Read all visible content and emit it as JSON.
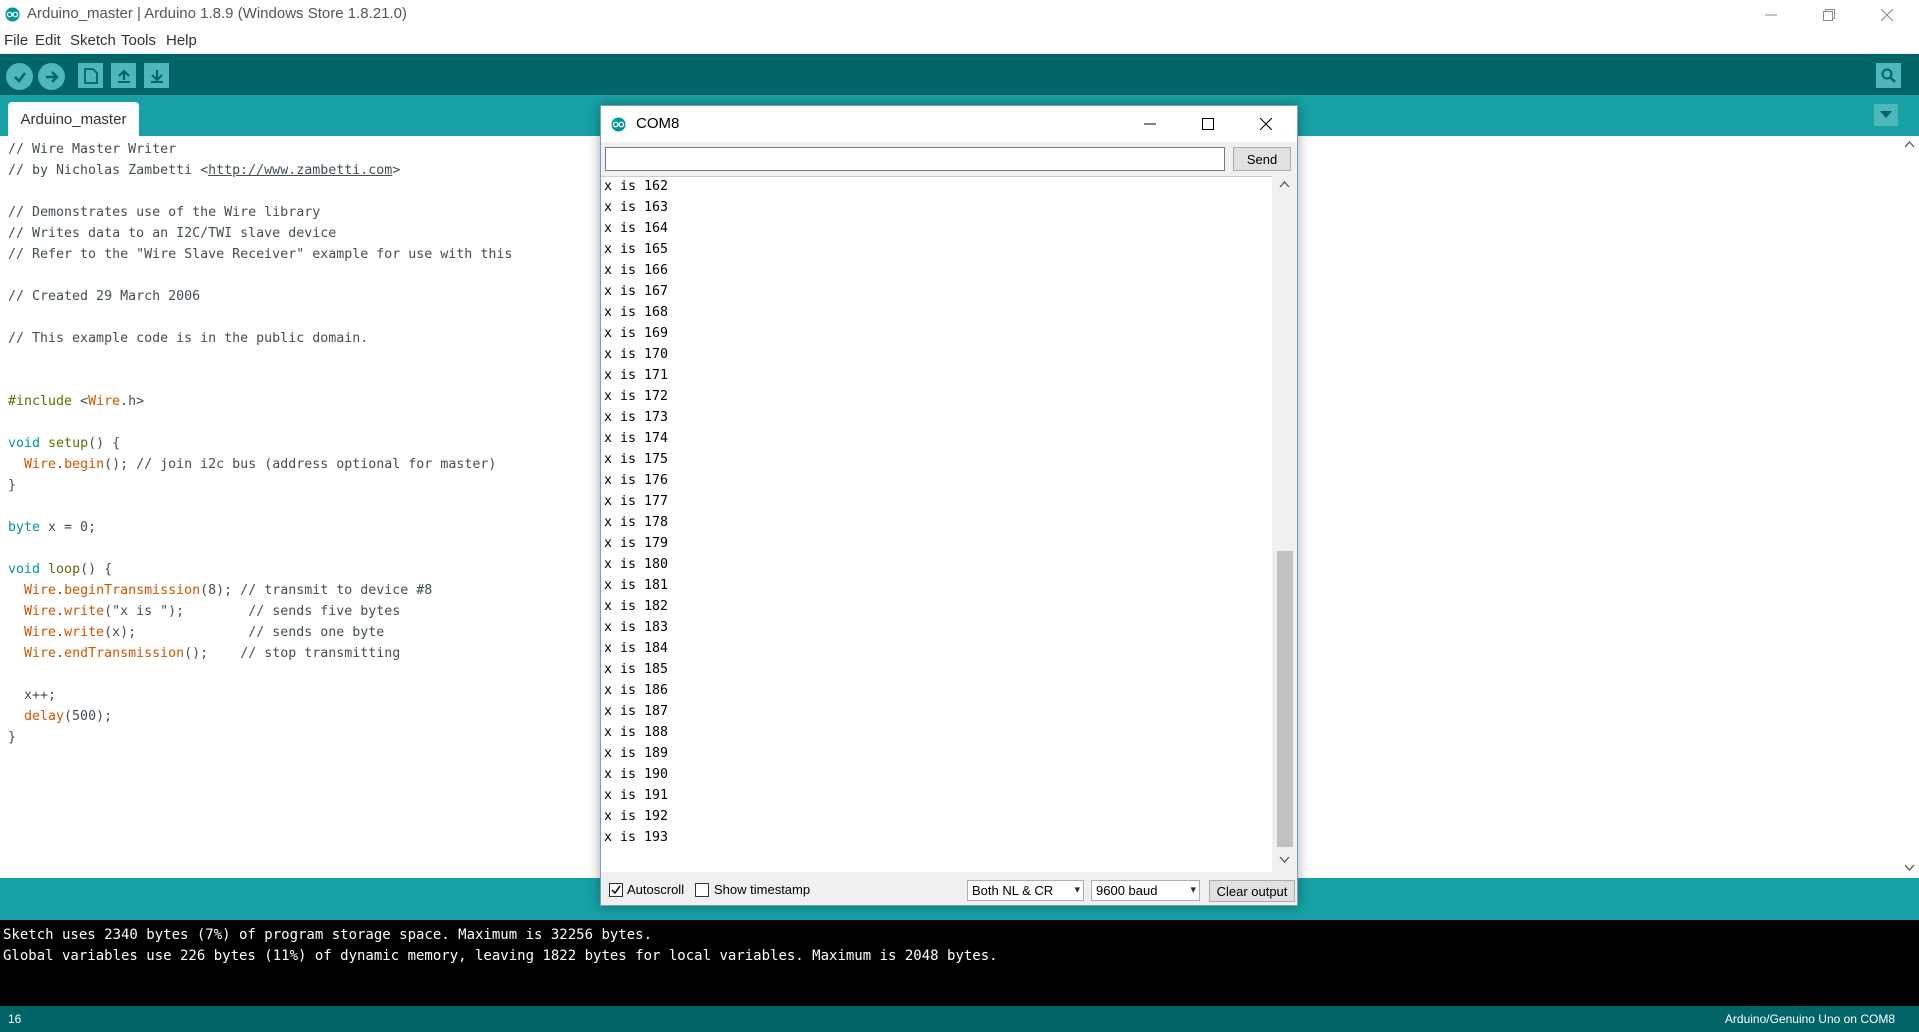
{
  "window": {
    "title": "Arduino_master | Arduino 1.8.9 (Windows Store 1.8.21.0)",
    "minimize": "—",
    "restore": "❐",
    "close": "✕"
  },
  "menu": [
    "File",
    "Edit",
    "Sketch",
    "Tools",
    "Help"
  ],
  "toolbar": {
    "verify": "✓",
    "upload": "→",
    "new": "new-icon",
    "open": "open-icon",
    "save": "save-icon",
    "serial_monitor": "serial-monitor-icon"
  },
  "tab": {
    "label": "Arduino_master"
  },
  "code_lines": [
    "// Wire Master Writer",
    "// by Nicholas Zambetti <http://www.zambetti.com>",
    "",
    "// Demonstrates use of the Wire library",
    "// Writes data to an I2C/TWI slave device",
    "// Refer to the \"Wire Slave Receiver\" example for use with this",
    "",
    "// Created 29 March 2006",
    "",
    "// This example code is in the public domain.",
    "",
    "",
    "#include <Wire.h>",
    "",
    "void setup() {",
    "  Wire.begin(); // join i2c bus (address optional for master)",
    "}",
    "",
    "byte x = 0;",
    "",
    "void loop() {",
    "  Wire.beginTransmission(8); // transmit to device #8",
    "  Wire.write(\"x is \");        // sends five bytes",
    "  Wire.write(x);              // sends one byte",
    "  Wire.endTransmission();    // stop transmitting",
    "",
    "  x++;",
    "  delay(500);",
    "}"
  ],
  "console": [
    "Sketch uses 2340 bytes (7%) of program storage space. Maximum is 32256 bytes.",
    "Global variables use 226 bytes (11%) of dynamic memory, leaving 1822 bytes for local variables. Maximum is 2048 bytes."
  ],
  "status": {
    "line": "16",
    "board": "Arduino/Genuino Uno on COM8"
  },
  "serial_monitor": {
    "title": "COM8",
    "input_value": "",
    "send_label": "Send",
    "output": [
      "x is 162",
      "x is 163",
      "x is 164",
      "x is 165",
      "x is 166",
      "x is 167",
      "x is 168",
      "x is 169",
      "x is 170",
      "x is 171",
      "x is 172",
      "x is 173",
      "x is 174",
      "x is 175",
      "x is 176",
      "x is 177",
      "x is 178",
      "x is 179",
      "x is 180",
      "x is 181",
      "x is 182",
      "x is 183",
      "x is 184",
      "x is 185",
      "x is 186",
      "x is 187",
      "x is 188",
      "x is 189",
      "x is 190",
      "x is 191",
      "x is 192",
      "x is 193"
    ],
    "autoscroll_label": "Autoscroll",
    "autoscroll_checked": true,
    "timestamp_label": "Show timestamp",
    "timestamp_checked": false,
    "line_ending": "Both NL & CR",
    "baud": "9600 baud",
    "clear_label": "Clear output"
  },
  "colors": {
    "toolbar": "#006468",
    "tabstrip": "#17a1a5",
    "button": "#4db7bb"
  }
}
